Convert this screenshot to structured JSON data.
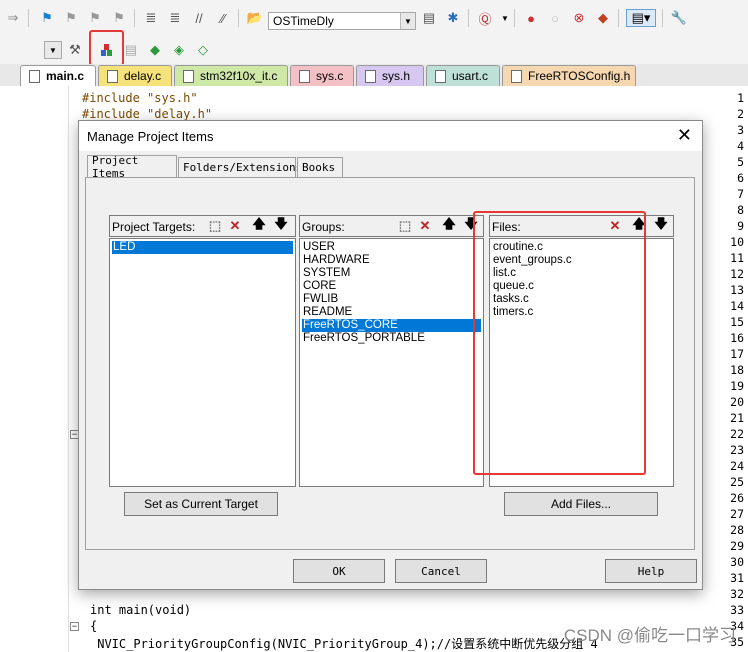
{
  "toolbar1": {
    "target_combo_value": "OSTimeDly"
  },
  "file_tabs": [
    {
      "label": "main.c",
      "color": "#c8dcf0",
      "active": true
    },
    {
      "label": "delay.c",
      "color": "#f6e27a"
    },
    {
      "label": "stm32f10x_it.c",
      "color": "#cfe8a8"
    },
    {
      "label": "sys.c",
      "color": "#f3c0c6"
    },
    {
      "label": "sys.h",
      "color": "#d6c8f0"
    },
    {
      "label": "usart.c",
      "color": "#bfe0d6"
    },
    {
      "label": "FreeRTOSConfig.h",
      "color": "#f6d8b0"
    }
  ],
  "editor": {
    "line_numbers": [
      "1",
      "2",
      "3",
      "4",
      "5",
      "6",
      "7",
      "8",
      "9",
      "10",
      "11",
      "12",
      "13",
      "14",
      "15",
      "16",
      "17",
      "18",
      "19",
      "20",
      "21",
      "22",
      "23",
      "24",
      "25",
      "26",
      "27",
      "28",
      "29",
      "30",
      "31",
      "32",
      "33",
      "34",
      "35"
    ],
    "line1": "#include \"sys.h\"",
    "line2": "#include \"delay.h\"",
    "line33": "int main(void)",
    "line34": "{",
    "line35": " NVIC_PriorityGroupConfig(NVIC_PriorityGroup_4);//设置系统中断优先级分组 4"
  },
  "dialog": {
    "title": "Manage Project Items",
    "close": "✕",
    "tabs": [
      "Project Items",
      "Folders/Extensions",
      "Books"
    ],
    "targets": {
      "header": "Project Targets:",
      "items": [
        "LED"
      ],
      "selected": "LED",
      "button": "Set as Current Target"
    },
    "groups": {
      "header": "Groups:",
      "items": [
        "USER",
        "HARDWARE",
        "SYSTEM",
        "CORE",
        "FWLIB",
        "README",
        "FreeRTOS_CORE",
        "FreeRTOS_PORTABLE"
      ],
      "selected": "FreeRTOS_CORE"
    },
    "files": {
      "header": "Files:",
      "items": [
        "croutine.c",
        "event_groups.c",
        "list.c",
        "queue.c",
        "tasks.c",
        "timers.c"
      ],
      "button": "Add Files..."
    },
    "ok": "OK",
    "cancel": "Cancel",
    "help": "Help"
  },
  "watermark": "CSDN @偷吃一口学习",
  "colors": {
    "selection": "#0078d7",
    "highlight_box": "#e53935",
    "include_color": "#7a4a00",
    "string_color": "#8b1010",
    "comment_color": "#008000"
  }
}
